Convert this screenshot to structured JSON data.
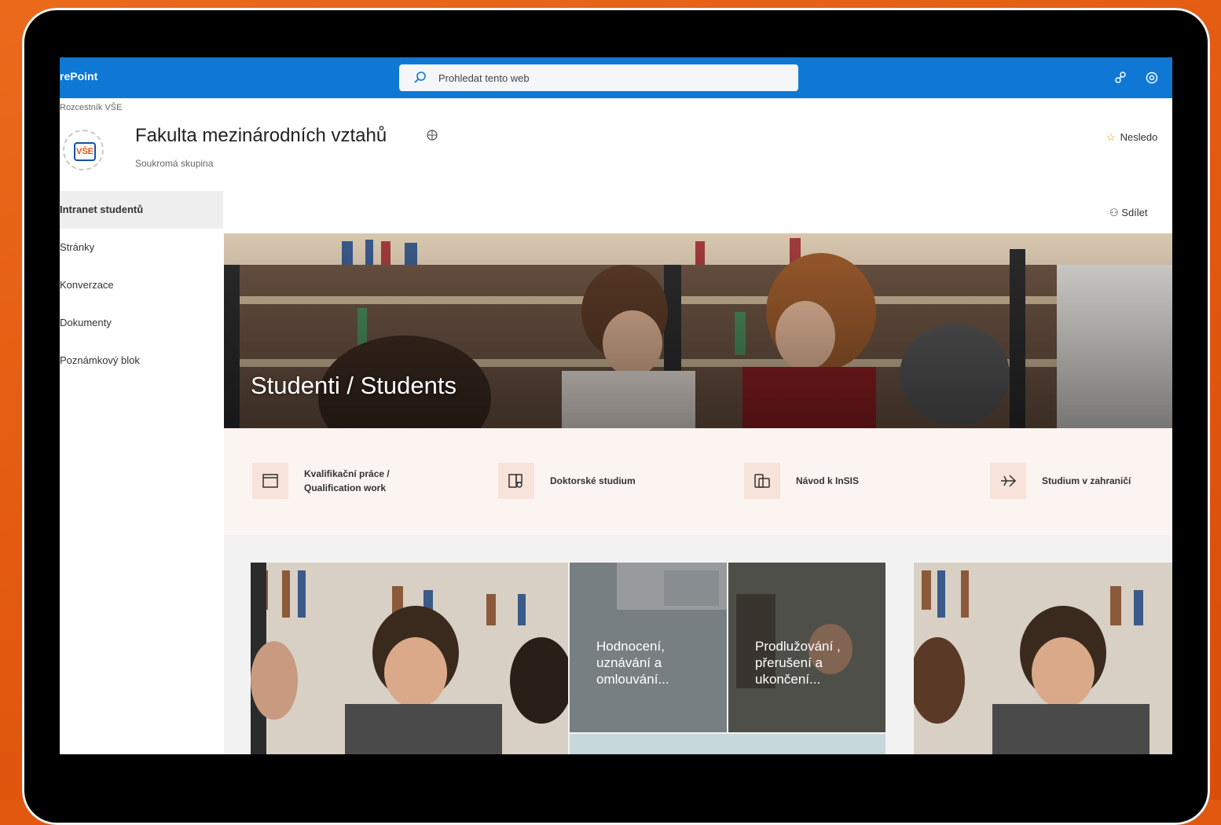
{
  "suite": {
    "app_name": "rePoint",
    "search_placeholder": "Prohledat tento web",
    "icons": [
      "share-icon",
      "settings-icon"
    ]
  },
  "header": {
    "breadcrumb": "Rozcestník VŠE",
    "logo_text": "VŠE",
    "title": "Fakulta mezinárodních vztahů",
    "subtitle": "Soukromá skupina",
    "follow_label": "Nesledo"
  },
  "nav": {
    "items": [
      {
        "label": "Intranet studentů",
        "active": true
      },
      {
        "label": "Stránky"
      },
      {
        "label": "Konverzace"
      },
      {
        "label": "Dokumenty"
      },
      {
        "label": "Poznámkový blok"
      }
    ]
  },
  "commandbar": {
    "share_label": "Sdílet"
  },
  "hero": {
    "caption": "Studenti / Students"
  },
  "quicklinks": [
    {
      "line1": "Kvalifikační práce /",
      "line2": "Qualification work",
      "icon": "thesis-icon"
    },
    {
      "line1": "Doktorské studium",
      "line2": "",
      "icon": "doctoral-icon"
    },
    {
      "line1": "Návod k InSIS",
      "line2": "",
      "icon": "guide-icon"
    },
    {
      "line1": "Studium v zahraničí",
      "line2": "",
      "icon": "airplane-icon"
    }
  ],
  "news": {
    "tile2": "Hodnocení, uznávání a omlouvání...",
    "tile3": "Prodlužování , přerušení a ukončení..."
  },
  "colors": {
    "suitebar": "#0f78d4",
    "accent": "#e0521a",
    "quicklink_bg": "#fcf4f0"
  }
}
